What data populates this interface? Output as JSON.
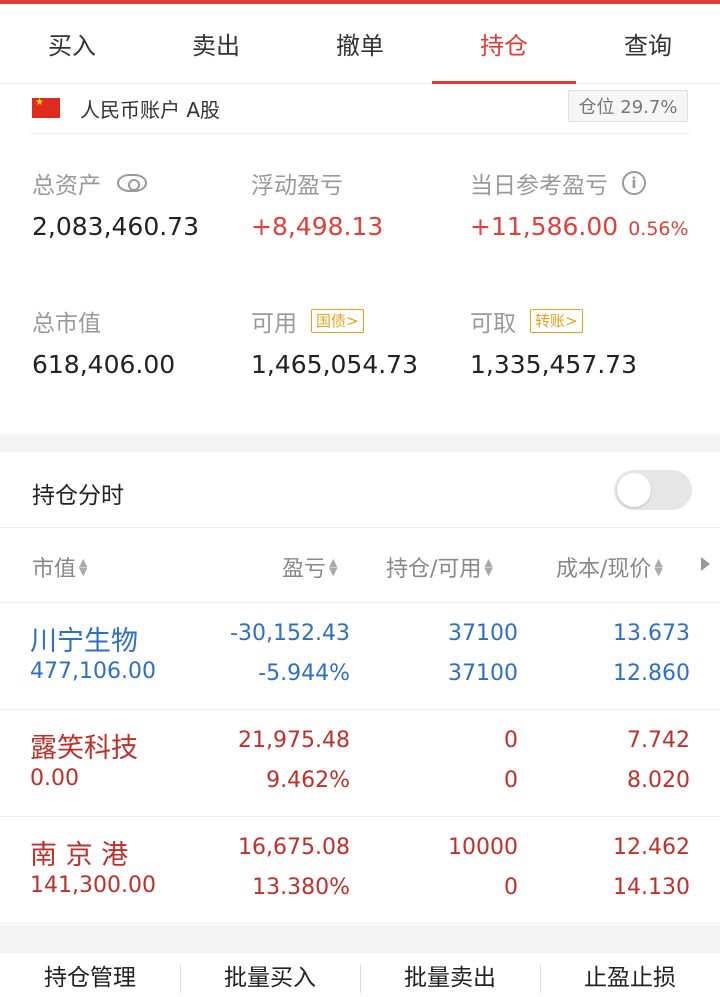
{
  "tabs": [
    {
      "label": "买入",
      "active": false
    },
    {
      "label": "卖出",
      "active": false
    },
    {
      "label": "撤单",
      "active": false
    },
    {
      "label": "持仓",
      "active": true
    },
    {
      "label": "查询",
      "active": false
    }
  ],
  "account": {
    "name": "人民币账户 A股",
    "position_label": "仓位 29.7%"
  },
  "metrics": {
    "total_assets": {
      "label": "总资产",
      "value": "2,083,460.73"
    },
    "floating_pl": {
      "label": "浮动盈亏",
      "value": "+8,498.13"
    },
    "daily_pl": {
      "label": "当日参考盈亏",
      "value": "+11,586.00",
      "pct": "0.56%"
    },
    "market_value": {
      "label": "总市值",
      "value": "618,406.00"
    },
    "available": {
      "label": "可用",
      "tag": "国债>",
      "value": "1,465,054.73"
    },
    "withdrawable": {
      "label": "可取",
      "tag": "转账>",
      "value": "1,335,457.73"
    }
  },
  "fenshi": {
    "label": "持仓分时",
    "enabled": false
  },
  "table": {
    "headers": [
      "市值",
      "盈亏",
      "持仓/可用",
      "成本/现价"
    ],
    "rows": [
      {
        "name": "川宁生物",
        "market_value": "477,106.00",
        "pl": "-30,152.43",
        "pl_pct": "-5.944%",
        "hold": "37100",
        "avail": "37100",
        "cost": "13.673",
        "price": "12.860",
        "tone": "loss"
      },
      {
        "name": "露笑科技",
        "market_value": "0.00",
        "pl": "21,975.48",
        "pl_pct": "9.462%",
        "hold": "0",
        "avail": "0",
        "cost": "7.742",
        "price": "8.020",
        "tone": "gain"
      },
      {
        "name": "南 京 港",
        "market_value": "141,300.00",
        "pl": "16,675.08",
        "pl_pct": "13.380%",
        "hold": "10000",
        "avail": "0",
        "cost": "12.462",
        "price": "14.130",
        "tone": "gain"
      }
    ]
  },
  "actions": [
    "持仓管理",
    "批量买入",
    "批量卖出",
    "止盈止损"
  ],
  "colors": {
    "accent": "#e13b35",
    "gain": "#e0403a",
    "loss": "#2f6fc6",
    "tag": "#e7a21a"
  }
}
